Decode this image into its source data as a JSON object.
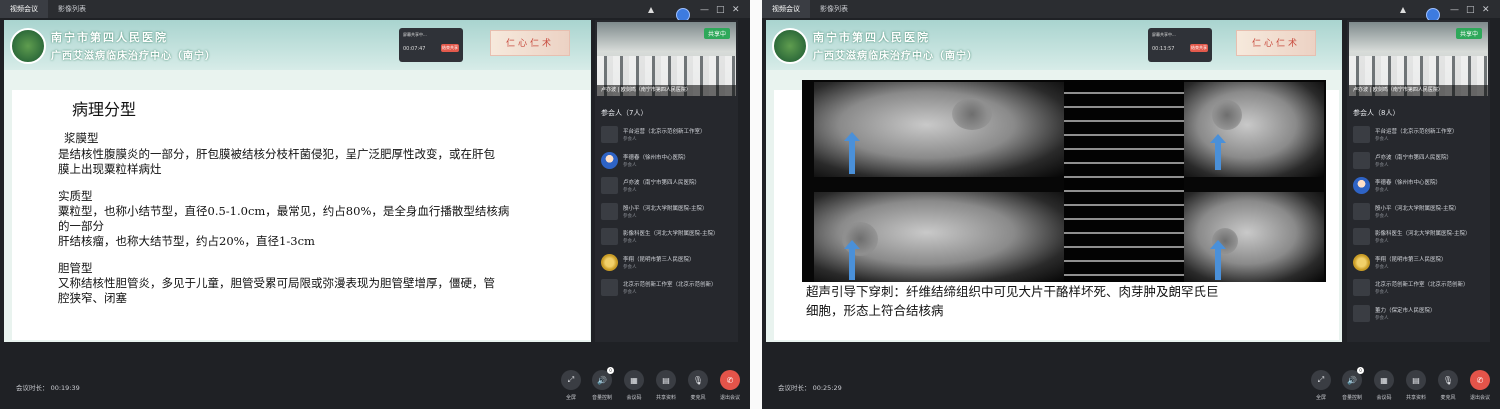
{
  "left": {
    "tabs": [
      "视频会议",
      "影像列表"
    ],
    "hospital": {
      "line1": "南宁市第四人民医院",
      "line2": "广西艾滋病临床治疗中心（南宁）"
    },
    "popup": {
      "title": "屏幕共享中...",
      "time": "00:07:47",
      "stop": "结束共享"
    },
    "calligraphy": "仁心仁术",
    "slide": {
      "title": "病理分型",
      "lines": [
        "浆膜型",
        "是结核性腹膜炎的一部分，肝包膜被结核分枝杆菌侵犯，呈广泛肥厚性改变，或在肝包",
        "膜上出现粟粒样病灶",
        "实质型",
        "粟粒型，也称小结节型，直径0.5-1.0cm，最常见，约占80%，是全身血行播散型结核病",
        "的一部分",
        "肝结核瘤，也称大结节型，约占20%，直径1-3cm",
        "胆管型",
        "又称结核性胆管炎，多见于儿童，胆管受累可局限或弥漫表现为胆管壁增厚，僵硬，管",
        "腔狭窄、闭塞"
      ]
    },
    "video": {
      "sharing": "共享中",
      "caption": "卢亦波 | 欧剑鸣（南宁市第四人民医院）"
    },
    "participants_title": "参会人（7人）",
    "participants": [
      {
        "name": "平台运营（北京示范创新工作室）",
        "role": "参会人",
        "avatar": "none"
      },
      {
        "name": "李德春（徐州市中心医院）",
        "role": "参会人",
        "avatar": "photo"
      },
      {
        "name": "卢亦波（南宁市第四人民医院）",
        "role": "参会人",
        "avatar": "none"
      },
      {
        "name": "殷小平（河北大学附属医院-主院）",
        "role": "参会人",
        "avatar": "none"
      },
      {
        "name": "影像科医生（河北大学附属医院-主院）",
        "role": "参会人",
        "avatar": "none"
      },
      {
        "name": "李翔（昆明市第三人民医院）",
        "role": "参会人",
        "avatar": "gold"
      },
      {
        "name": "北京示范创新工作室（北京示范创新）",
        "role": "参会人",
        "avatar": "none"
      }
    ],
    "duration": "会议时长： 00:19:39"
  },
  "right": {
    "tabs": [
      "视频会议",
      "影像列表"
    ],
    "hospital": {
      "line1": "南宁市第四人民医院",
      "line2": "广西艾滋病临床治疗中心（南宁）"
    },
    "popup": {
      "title": "屏幕共享中...",
      "time": "00:13:57",
      "stop": "结束共享"
    },
    "calligraphy": "仁心仁术",
    "caption": [
      "超声引导下穿刺：纤维结缔组织中可见大片干酪样坏死、肉芽肿及朗罕氏巨",
      "细胞，形态上符合结核病"
    ],
    "video": {
      "sharing": "共享中",
      "caption": "卢亦波 | 欧剑鸣（南宁市第四人民医院）"
    },
    "participants_title": "参会人（8人）",
    "participants": [
      {
        "name": "平台运营（北京示范创新工作室）",
        "role": "参会人",
        "avatar": "none"
      },
      {
        "name": "卢亦波（南宁市第四人民医院）",
        "role": "参会人",
        "avatar": "none"
      },
      {
        "name": "李德春（徐州市中心医院）",
        "role": "参会人",
        "avatar": "photo"
      },
      {
        "name": "殷小平（河北大学附属医院-主院）",
        "role": "参会人",
        "avatar": "none"
      },
      {
        "name": "影像科医生（河北大学附属医院-主院）",
        "role": "参会人",
        "avatar": "none"
      },
      {
        "name": "李翔（昆明市第三人民医院）",
        "role": "参会人",
        "avatar": "gold"
      },
      {
        "name": "北京示范创新工作室（北京示范创新）",
        "role": "参会人",
        "avatar": "none"
      },
      {
        "name": "董力（保定市人民医院）",
        "role": "参会人",
        "avatar": "none"
      }
    ],
    "duration": "会议时长： 00:25:29"
  },
  "controls": [
    {
      "icon": "fullscreen-icon",
      "glyph": "⤢",
      "label": "全屏"
    },
    {
      "icon": "volume-icon",
      "glyph": "🔊",
      "label": "音量控制",
      "badge": "0"
    },
    {
      "icon": "qrcode-icon",
      "glyph": "▦",
      "label": "会议码"
    },
    {
      "icon": "document-icon",
      "glyph": "▤",
      "label": "共享资料"
    },
    {
      "icon": "microphone-icon",
      "glyph": "🎙",
      "label": "麦克风"
    },
    {
      "icon": "hangup-icon",
      "glyph": "✆",
      "label": "退出会议",
      "red": true
    }
  ]
}
